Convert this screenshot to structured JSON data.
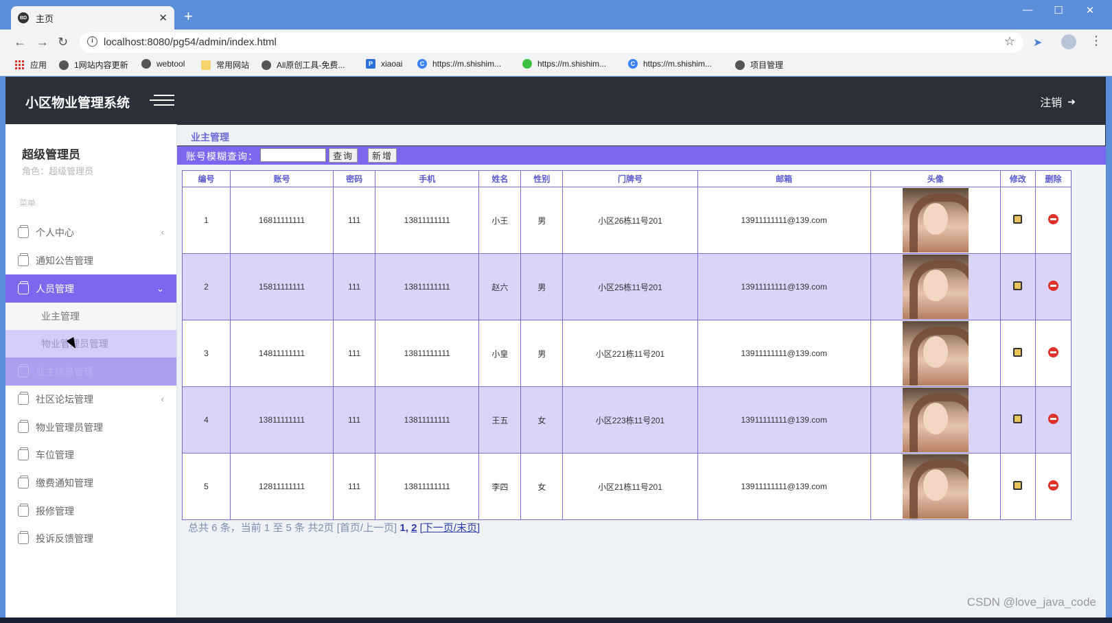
{
  "browser": {
    "tab_title": "主页",
    "tab_favicon": "BD",
    "url": "localhost:8080/pg54/admin/index.html",
    "bookmarks": [
      {
        "label": "应用",
        "icon": "apps-grid-icon"
      },
      {
        "label": "1网站内容更新",
        "icon": "globe-icon"
      },
      {
        "label": "webtool",
        "icon": "globe-icon"
      },
      {
        "label": "常用网站",
        "icon": "folder-icon"
      },
      {
        "label": "All原创工具-免费...",
        "icon": "globe-icon"
      },
      {
        "label": "xiaoai",
        "icon": "p-icon"
      },
      {
        "label": "https://m.shishim...",
        "icon": "c-icon"
      },
      {
        "label": "https://m.shishim...",
        "icon": "wechat-icon"
      },
      {
        "label": "https://m.shishim...",
        "icon": "c-icon"
      },
      {
        "label": "项目管理",
        "icon": "globe-icon"
      }
    ]
  },
  "app": {
    "title": "小区物业管理系统",
    "logout_label": "注销"
  },
  "sidebar": {
    "user_name": "超级管理员",
    "user_role": "角色：超级管理员",
    "menu_caption": "菜单",
    "items": [
      {
        "label": "个人中心",
        "arrow": "‹"
      },
      {
        "label": "通知公告管理",
        "arrow": ""
      },
      {
        "label": "人员管理",
        "arrow": "⌄"
      },
      {
        "label": "业主管理"
      },
      {
        "label": "物业管理员管理"
      },
      {
        "label": "业主信息管理",
        "arrow": "‹"
      },
      {
        "label": "社区论坛管理",
        "arrow": "‹"
      },
      {
        "label": "物业管理员管理",
        "arrow": ""
      },
      {
        "label": "车位管理",
        "arrow": ""
      },
      {
        "label": "缴费通知管理",
        "arrow": ""
      },
      {
        "label": "报修管理",
        "arrow": ""
      },
      {
        "label": "投诉反馈管理",
        "arrow": ""
      }
    ]
  },
  "page": {
    "breadcrumb": "业主管理",
    "search_label": "账号模糊查询：",
    "search_value": "",
    "query_button": "查询",
    "add_button": "新增"
  },
  "table": {
    "headers": [
      "编号",
      "账号",
      "密码",
      "手机",
      "姓名",
      "性别",
      "门牌号",
      "邮箱",
      "头像",
      "修改",
      "删除"
    ],
    "rows": [
      {
        "id": "1",
        "account": "16811111111",
        "password": "111",
        "phone": "13811111111",
        "name": "小王",
        "gender": "男",
        "door": "小区26栋11号201",
        "email": "13911111111@139.com"
      },
      {
        "id": "2",
        "account": "15811111111",
        "password": "111",
        "phone": "13811111111",
        "name": "赵六",
        "gender": "男",
        "door": "小区25栋11号201",
        "email": "13911111111@139.com"
      },
      {
        "id": "3",
        "account": "14811111111",
        "password": "111",
        "phone": "13811111111",
        "name": "小皇",
        "gender": "男",
        "door": "小区221栋11号201",
        "email": "13911111111@139.com"
      },
      {
        "id": "4",
        "account": "13811111111",
        "password": "111",
        "phone": "13811111111",
        "name": "王五",
        "gender": "女",
        "door": "小区223栋11号201",
        "email": "13911111111@139.com"
      },
      {
        "id": "5",
        "account": "12811111111",
        "password": "111",
        "phone": "13811111111",
        "name": "李四",
        "gender": "女",
        "door": "小区21栋11号201",
        "email": "13911111111@139.com"
      }
    ]
  },
  "pager": {
    "summary": "总共 6 条，当前 1 至 5 条 共2页",
    "first_prev": "[首页/上一页]",
    "page1": "1",
    "sep": ",",
    "page2": "2",
    "open_bracket": "[",
    "next": "下一页",
    "slash": "/",
    "last": "末页",
    "close_bracket": "]"
  },
  "watermark": "CSDN @love_java_code",
  "colors": {
    "accent": "#7b68ee",
    "row_alt": "#dad4fb",
    "header_bg": "#2b2f3a"
  }
}
